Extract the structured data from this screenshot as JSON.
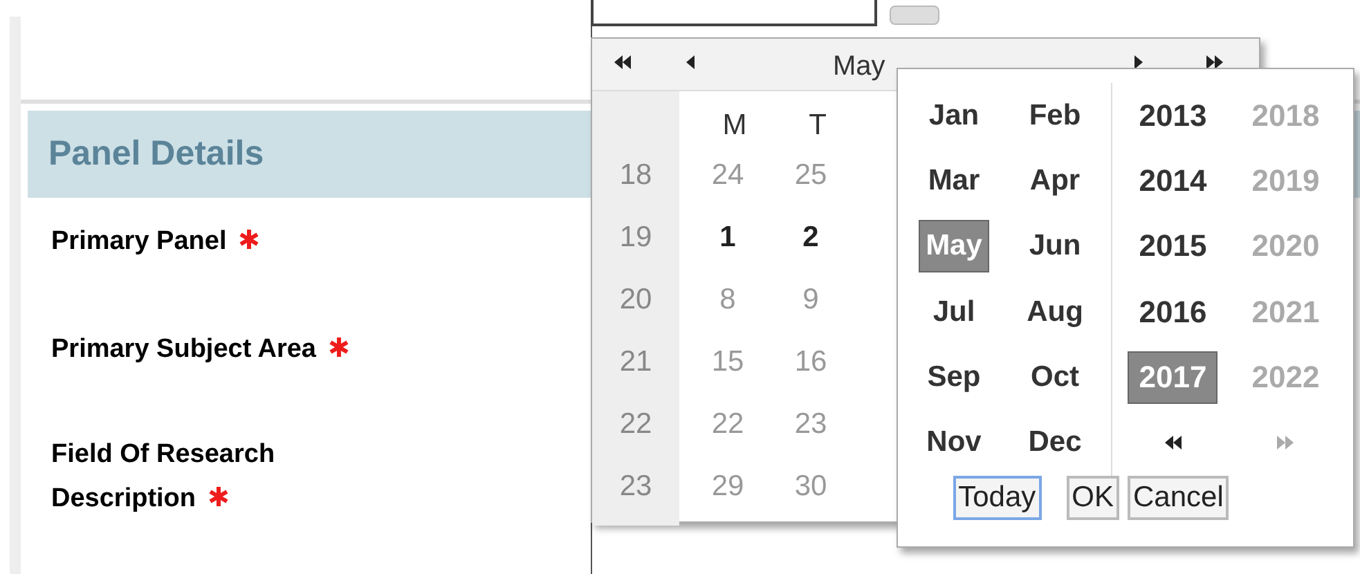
{
  "panel": {
    "title": "Panel Details",
    "fields": [
      {
        "label": "Primary Panel",
        "required": true
      },
      {
        "label": "Primary Subject Area",
        "required": true
      },
      {
        "label": "Field Of Research Description",
        "required": true
      }
    ]
  },
  "calendar": {
    "title": "May",
    "weekdays": [
      "M",
      "T"
    ],
    "weeks": [
      {
        "number": "18",
        "days": [
          {
            "text": "24",
            "disabled": true
          },
          {
            "text": "25",
            "disabled": true
          }
        ]
      },
      {
        "number": "19",
        "days": [
          {
            "text": "1",
            "disabled": false
          },
          {
            "text": "2",
            "disabled": false
          }
        ]
      },
      {
        "number": "20",
        "days": [
          {
            "text": "8",
            "disabled": true
          },
          {
            "text": "9",
            "disabled": true
          }
        ]
      },
      {
        "number": "21",
        "days": [
          {
            "text": "15",
            "disabled": true
          },
          {
            "text": "16",
            "disabled": true
          }
        ]
      },
      {
        "number": "22",
        "days": [
          {
            "text": "22",
            "disabled": true
          },
          {
            "text": "23",
            "disabled": true
          }
        ]
      },
      {
        "number": "23",
        "days": [
          {
            "text": "29",
            "disabled": true
          },
          {
            "text": "30",
            "disabled": true
          }
        ]
      }
    ]
  },
  "month_year_picker": {
    "months": [
      {
        "text": "Jan",
        "selected": false
      },
      {
        "text": "Feb",
        "selected": false
      },
      {
        "text": "Mar",
        "selected": false
      },
      {
        "text": "Apr",
        "selected": false
      },
      {
        "text": "May",
        "selected": true
      },
      {
        "text": "Jun",
        "selected": false
      },
      {
        "text": "Jul",
        "selected": false
      },
      {
        "text": "Aug",
        "selected": false
      },
      {
        "text": "Sep",
        "selected": false
      },
      {
        "text": "Oct",
        "selected": false
      },
      {
        "text": "Nov",
        "selected": false
      },
      {
        "text": "Dec",
        "selected": false
      }
    ],
    "years": [
      {
        "text": "2013",
        "selected": false,
        "disabled": false
      },
      {
        "text": "2018",
        "selected": false,
        "disabled": true
      },
      {
        "text": "2014",
        "selected": false,
        "disabled": false
      },
      {
        "text": "2019",
        "selected": false,
        "disabled": true
      },
      {
        "text": "2015",
        "selected": false,
        "disabled": false
      },
      {
        "text": "2020",
        "selected": false,
        "disabled": true
      },
      {
        "text": "2016",
        "selected": false,
        "disabled": false
      },
      {
        "text": "2021",
        "selected": false,
        "disabled": true
      },
      {
        "text": "2017",
        "selected": true,
        "disabled": false
      },
      {
        "text": "2022",
        "selected": false,
        "disabled": true
      }
    ],
    "buttons": [
      {
        "label": "Today",
        "focused": true
      },
      {
        "label": "OK",
        "focused": false
      },
      {
        "label": "Cancel",
        "focused": false
      }
    ]
  }
}
